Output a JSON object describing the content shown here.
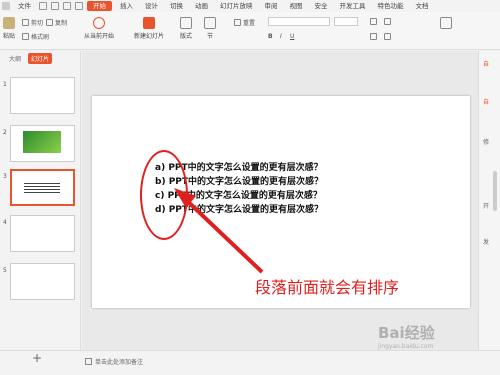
{
  "menubar": {
    "file": "文件",
    "tabs": [
      "开始",
      "插入",
      "设计",
      "切换",
      "动画",
      "幻灯片放映",
      "审阅",
      "视图",
      "安全",
      "开发工具",
      "特色功能",
      "文档"
    ]
  },
  "ribbon": {
    "paste": "粘贴",
    "cut": "剪切",
    "copy": "复制",
    "format_painter": "格式刷",
    "from_current": "从当前开始",
    "new_slide": "新建幻灯片",
    "layout": "版式",
    "section": "节",
    "reset": "重置"
  },
  "left_panel": {
    "tabs": [
      "大纲",
      "幻灯片"
    ],
    "slides": [
      "1",
      "2",
      "3",
      "4",
      "5"
    ],
    "add": "+"
  },
  "slide": {
    "lines": [
      "a)  PPT中的文字怎么设置的更有层次感？",
      "b)  PPT中的文字怎么设置的更有层次感？",
      "c)  PPT中的文字怎么设置的更有层次感？",
      "d)  PPT中的文字怎么设置的更有层次感？"
    ],
    "annotation": "段落前面就会有排序"
  },
  "right_panel": {
    "labels": [
      "自",
      "自",
      "修",
      "开",
      "发"
    ]
  },
  "statusbar": {
    "notes": "单击此处添加备注"
  },
  "watermark": {
    "brand": "Bai经验",
    "url": "jingyan.baidu.com"
  },
  "colors": {
    "accent": "#e8542e",
    "annotation": "#e02020"
  }
}
